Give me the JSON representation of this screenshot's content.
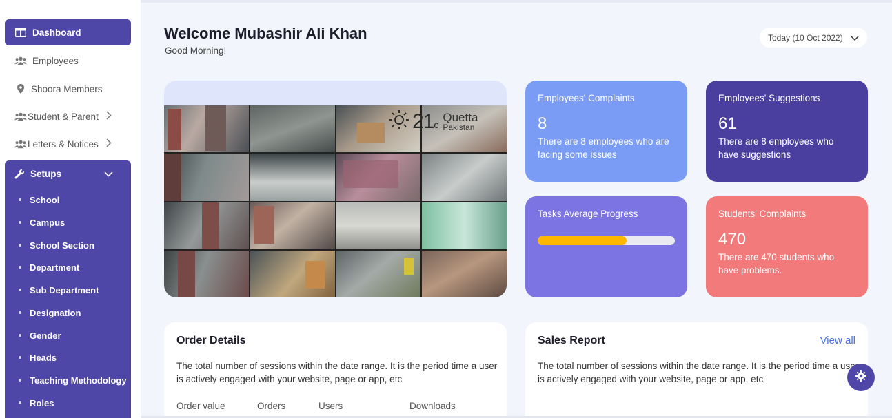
{
  "sidebar": {
    "items": [
      {
        "label": "Dashboard",
        "icon": "dashboard-icon"
      },
      {
        "label": "Employees",
        "icon": "people-icon"
      },
      {
        "label": "Shoora Members",
        "icon": "location-pin-icon"
      },
      {
        "label": "Student & Parent",
        "icon": "people-icon"
      },
      {
        "label": "Letters & Notices",
        "icon": "people-icon"
      }
    ],
    "setups": {
      "label": "Setups",
      "icon": "wrench-icon",
      "children": [
        "School",
        "Campus",
        "School Section",
        "Department",
        "Sub Department",
        "Designation",
        "Gender",
        "Heads",
        "Teaching Methodology",
        "Roles"
      ]
    },
    "accent_color": "#4f47a8"
  },
  "header": {
    "welcome": "Welcome Mubashir Ali Khan",
    "greeting": "Good Morning!",
    "date_filter": "Today (10 Oct 2022)"
  },
  "weather": {
    "icon": "sun-icon",
    "temperature": "21",
    "unit": "c",
    "city": "Quetta",
    "country": "Pakistan"
  },
  "stats": {
    "employee_complaints": {
      "title": "Employees' Complaints",
      "value": "8",
      "description": "There are 8 employees who are facing some issues",
      "color": "#7b9cf5"
    },
    "employee_suggestions": {
      "title": "Employees' Suggestions",
      "value": "61",
      "description": "There are 8 employees who have suggestions",
      "color": "#4a3f9e"
    },
    "tasks_progress": {
      "title": "Tasks Average Progress",
      "progress_fraction": 0.65,
      "color": "#7b74e2",
      "bar_color": "#ffb700"
    },
    "student_complaints": {
      "title": "Students' Complaints",
      "value": "470",
      "description": "There are 470 students who have problems.",
      "color": "#f27a7a"
    }
  },
  "order_details": {
    "title": "Order Details",
    "description": "The total number of sessions within the date range. It is the period time a user is actively engaged with your website, page or app, etc",
    "columns": [
      "Order value",
      "Orders",
      "Users",
      "Downloads"
    ]
  },
  "sales_report": {
    "title": "Sales Report",
    "view_all": "View all",
    "description": "The total number of sessions within the date range. It is the period time a user is actively engaged with your website, page or app, etc"
  },
  "settings_fab": {
    "icon": "gear-icon"
  }
}
